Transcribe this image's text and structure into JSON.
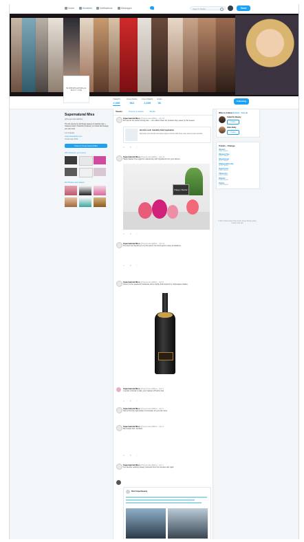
{
  "nav": {
    "items": [
      "Home",
      "Moments",
      "Notifications",
      "Messages"
    ],
    "search_placeholder": "Search Twitter",
    "tweet_label": "Tweet"
  },
  "profile": {
    "logo_line1": "SUPERNATURAL",
    "logo_line2": "BEAUTY CODE",
    "stats": [
      {
        "label": "TWEETS",
        "value": "2,098"
      },
      {
        "label": "FOLLOWING",
        "value": "562"
      },
      {
        "label": "FOLLOWERS",
        "value": "1,609"
      },
      {
        "label": "LIKES",
        "value": "56"
      }
    ],
    "follow_label": "Following",
    "name": "Supernatural Miss",
    "handle": "@SupernaturalMiss",
    "bio": "The #1 source for all things beauty & celebrity hair + makeup looks. Powerful products, pro tricks and beauty you can trust.",
    "location": "Los Angeles",
    "website": "supernaturalmiss.com",
    "joined": "Joined July 2011",
    "tweet_to_label": "Tweet to Supernatural Miss",
    "followers_you_know": "38 Followers you know",
    "photos_label": "52 Photos and videos"
  },
  "timeline": {
    "tabs": [
      "Tweets",
      "Tweets & replies",
      "Media"
    ],
    "tweets": [
      {
        "name": "Supernatural Miss",
        "handle": "@SupernaturalMiss · Apr 14",
        "text": "Pro tips for the perfect spring look — our editors share the products they swear by this season."
      },
      {
        "name": "Supernatural Miss",
        "handle": "@SupernaturalMiss · Apr 12",
        "text": "Happy Easter! Dye eggs the natural way with ingredients from your kitchen."
      },
      {
        "name": "Supernatural Miss",
        "handle": "@SupernaturalMiss · Apr 10",
        "text": "The best new launches to try this week, from brow gels to dewy foundations."
      },
      {
        "name": "Supernatural Miss",
        "handle": "@SupernaturalMiss · Apr 8",
        "text": "Cheers to the weekend! Celebrate with a bubbly look inspired by champagne shades."
      },
      {
        "name": "Supernatural Miss",
        "handle": "@SupernaturalMiss · Apr 6",
        "text": "A gentle reminder to take your makeup off before bed."
      },
      {
        "name": "Supernatural Miss",
        "handle": "@SupernaturalMiss · Apr 5",
        "text": "How to find the right shade of concealer for your skin tone."
      },
      {
        "name": "Supernatural Miss",
        "handle": "@SupernaturalMiss · Apr 3",
        "text": "Red carpet hair, decoded."
      },
      {
        "name": "Supernatural Miss",
        "handle": "@SupernaturalMiss · Apr 1",
        "text": "Our favorite celebrity beauty moments from the premiere last night."
      }
    ],
    "card_title": "Get the Look: Celebrity Hair Inspiration",
    "card_desc": "Recreate your favorite red carpet styles at home with these easy step-by-step tutorials.",
    "easter_sign": "Happy Easter",
    "quoted_name": "Red Carpet Beauty"
  },
  "sidebar": {
    "who_to_follow": "Who to follow",
    "refresh": "Refresh · View all",
    "suggestions": [
      {
        "name": "Celebrity Beauty",
        "follow": "Follow"
      },
      {
        "name": "Glam Daily",
        "follow": "Follow"
      }
    ],
    "trends_title": "Trends · Change",
    "trends": [
      {
        "tag": "#Easter",
        "count": "152K Tweets"
      },
      {
        "tag": "#BeautyTips",
        "count": "24.1K Tweets"
      },
      {
        "tag": "#RedCarpet",
        "count": "18.7K Tweets"
      },
      {
        "tag": "#MakeupMonday",
        "count": "12.3K Tweets"
      },
      {
        "tag": "#HairGoals",
        "count": "9,840 Tweets"
      },
      {
        "tag": "#Skincare",
        "count": "8,112 Tweets"
      },
      {
        "tag": "#NewIn",
        "count": "5,406 Tweets"
      },
      {
        "tag": "#Glam",
        "count": "3,290 Tweets"
      }
    ],
    "footer": "© 2017 Twitter About Help Center Terms Privacy policy Cookies Ads info"
  },
  "colors": {
    "accent": "#1da1f2",
    "banner_bg": "#1a1416"
  }
}
